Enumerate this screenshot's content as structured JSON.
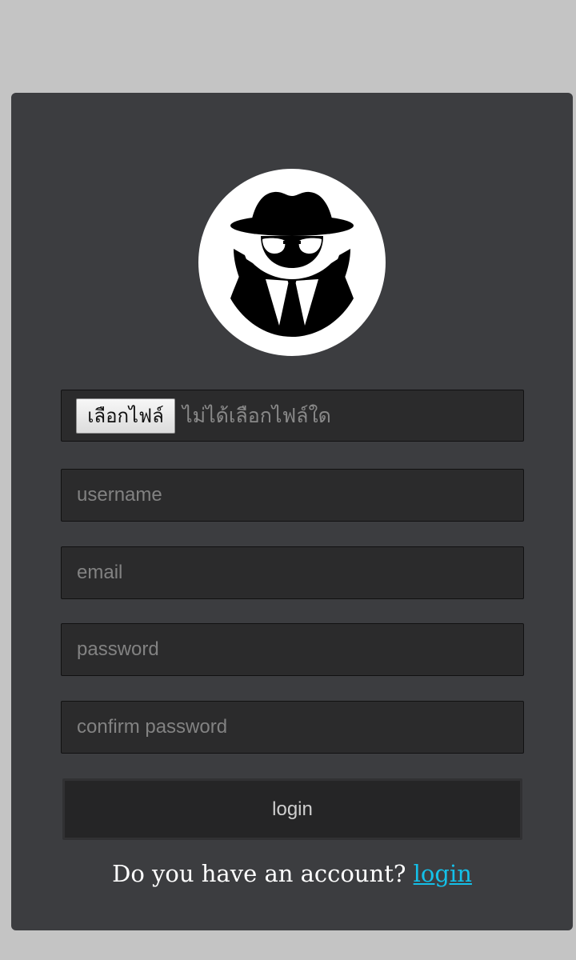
{
  "avatar": {
    "icon": "incognito-spy-icon"
  },
  "file_input": {
    "button_label": "เลือกไฟล์",
    "status_text": "ไม่ได้เลือกไฟล์ใด"
  },
  "fields": {
    "username": {
      "placeholder": "username",
      "value": ""
    },
    "email": {
      "placeholder": "email",
      "value": ""
    },
    "password": {
      "placeholder": "password",
      "value": ""
    },
    "confirm_password": {
      "placeholder": "confirm password",
      "value": ""
    }
  },
  "submit": {
    "label": "login"
  },
  "footer": {
    "question": "Do you have an account?",
    "link_label": "login"
  },
  "colors": {
    "page_background": "#c4c4c4",
    "card_background": "#3c3d40",
    "input_background": "#2b2b2c",
    "button_background": "#252526",
    "link": "#14c0e8"
  }
}
